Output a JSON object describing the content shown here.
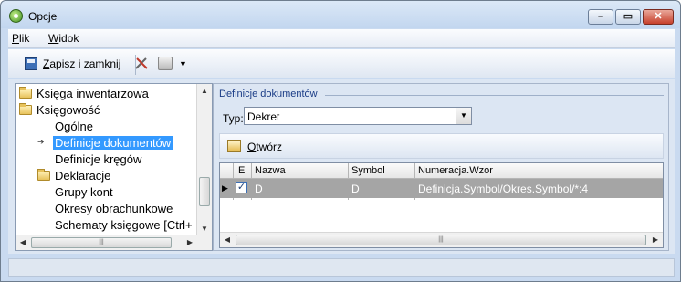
{
  "window": {
    "title": "Opcje"
  },
  "menu": [
    {
      "accel": "P",
      "rest": "lik"
    },
    {
      "accel": "W",
      "rest": "idok"
    }
  ],
  "toolbar": {
    "save_accel": "Z",
    "save_rest": "apisz i zamknij",
    "icons": [
      "save-icon",
      "tools-icon",
      "print-icon",
      "chevron-down-icon"
    ]
  },
  "tree": {
    "items": [
      {
        "label": "Księga inwentarzowa",
        "type": "folder"
      },
      {
        "label": "Księgowość",
        "type": "folder"
      },
      {
        "label": "Ogólne",
        "type": "leaf"
      },
      {
        "label": "Definicje dokumentów",
        "type": "leaf",
        "selected": true
      },
      {
        "label": "Definicje kręgów",
        "type": "leaf"
      },
      {
        "label": "Deklaracje",
        "type": "folder"
      },
      {
        "label": "Grupy kont",
        "type": "leaf"
      },
      {
        "label": "Okresy obrachunkowe",
        "type": "leaf"
      },
      {
        "label": "Schematy księgowe [Ctrl+",
        "type": "leaf"
      }
    ]
  },
  "panel": {
    "title": "Definicje dokumentów",
    "typ_label": "Typ:",
    "typ_value": "Dekret",
    "open_accel": "O",
    "open_rest": "twórz"
  },
  "grid": {
    "columns": [
      "E",
      "Nazwa",
      "Symbol",
      "Numeracja.Wzor"
    ],
    "rows": [
      {
        "E": true,
        "Nazwa": "D",
        "Symbol": "D",
        "Numeracja": "Definicja.Symbol/Okres.Symbol/*:4"
      }
    ]
  },
  "colors": {
    "selection": "#3399ff",
    "row_highlight": "#a5a5a5",
    "panel_title": "#1a3c86"
  }
}
